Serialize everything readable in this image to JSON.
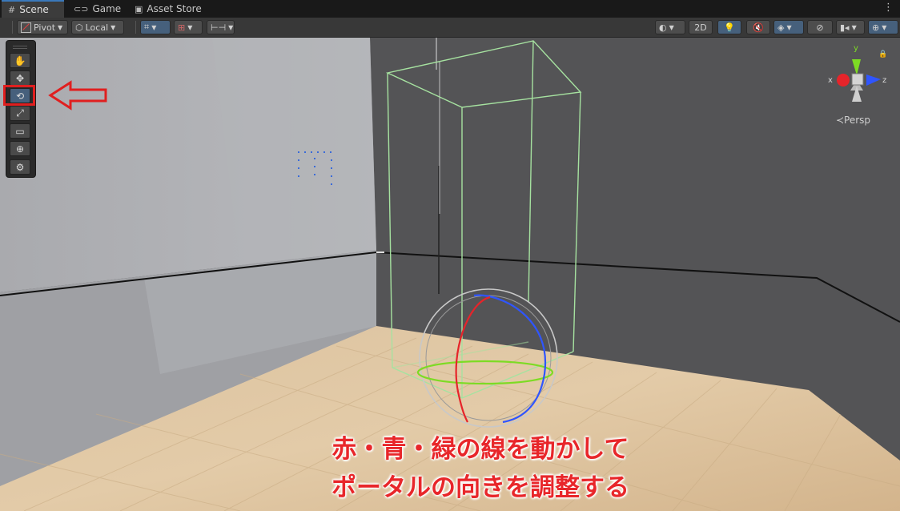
{
  "tabs": [
    {
      "label": "Scene",
      "icon": "grid-icon"
    },
    {
      "label": "Game",
      "icon": "gamepad-icon"
    },
    {
      "label": "Asset Store",
      "icon": "shopping-bag-icon"
    }
  ],
  "toolbar": {
    "pivot_label": "Pivot",
    "space_label": "Local",
    "mode_2d_label": "2D"
  },
  "tools": [
    {
      "name": "hand-tool-button",
      "icon": "✋"
    },
    {
      "name": "move-tool-button",
      "icon": "✥"
    },
    {
      "name": "rotate-tool-button",
      "icon": "⟲",
      "selected": true
    },
    {
      "name": "scale-tool-button",
      "icon": "⤢"
    },
    {
      "name": "rect-tool-button",
      "icon": "▭"
    },
    {
      "name": "transform-tool-button",
      "icon": "⊕"
    },
    {
      "name": "custom-tool-button",
      "icon": "⚙"
    }
  ],
  "gizmo": {
    "y_label": "y",
    "x_label": "x",
    "z_label": "z",
    "projection_label": "≺Persp"
  },
  "annotation": {
    "line1": "赤・青・緑の線を動かして",
    "line2": "ポータルの向きを調整する",
    "color": "#e8262a"
  },
  "colors": {
    "accent": "#46607c",
    "highlight": "#e01f1f"
  }
}
